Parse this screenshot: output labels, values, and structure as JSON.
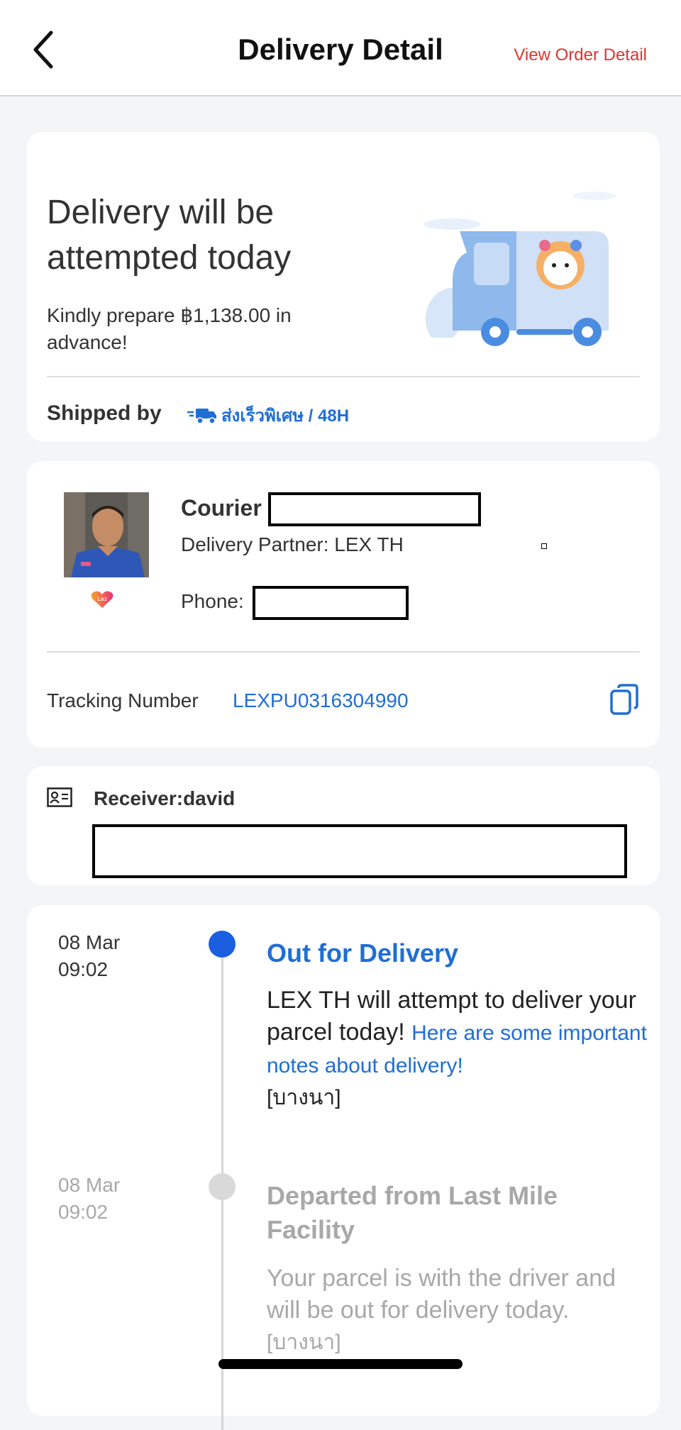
{
  "header": {
    "title": "Delivery Detail",
    "view_order": "View Order Detail"
  },
  "status_card": {
    "headline": "Delivery will be attempted today",
    "prepare": "Kindly prepare ฿1,138.00 in advance!",
    "shipped_by_label": "Shipped by",
    "shipping_service": "ส่งเร็วพิเศษ / 48H"
  },
  "courier_card": {
    "courier_label": "Courier",
    "delivery_partner": "Delivery Partner: LEX TH",
    "phone_label": "Phone:",
    "avatar_badge": "Laz",
    "tracking_label": "Tracking Number",
    "tracking_number": "LEXPU0316304990"
  },
  "receiver_card": {
    "receiver": "Receiver:david"
  },
  "timeline": [
    {
      "date": "08 Mar",
      "time": "09:02",
      "title": "Out for Delivery",
      "desc": "LEX TH will attempt to deliver your parcel today!",
      "link": "Here are some important notes about delivery!",
      "location": "[บางนา]",
      "active": true
    },
    {
      "date": "08 Mar",
      "time": "09:02",
      "title": "Departed from Last Mile Facility",
      "desc": "Your parcel is with the driver and will be out for delivery today.",
      "location": "[บางนา]",
      "active": false
    }
  ],
  "colors": {
    "brand_red": "#e0342f",
    "link_blue": "#1f6ed4",
    "active_dot": "#1a5fe0",
    "inactive_text": "#a8a8a8"
  }
}
